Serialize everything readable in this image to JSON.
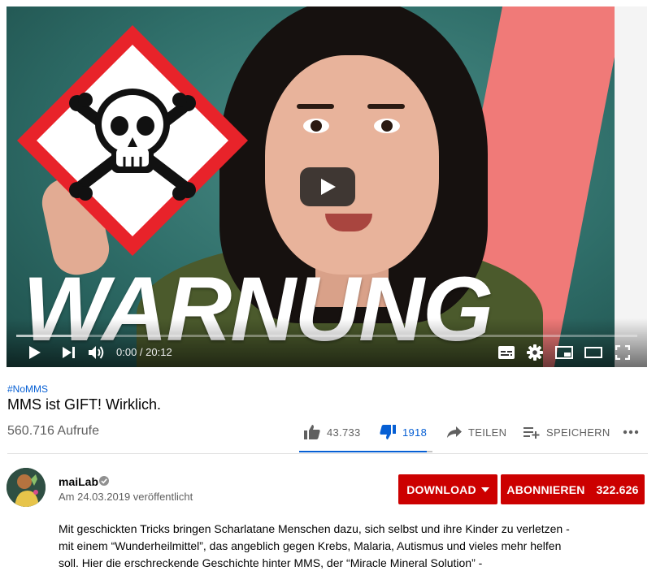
{
  "player": {
    "thumbnail_text": "WARNUNG",
    "time_current": "0:00",
    "time_separator": " / ",
    "time_total": "20:12",
    "progress_loaded_fraction": 0.09,
    "icons": [
      "play-icon",
      "next-icon",
      "volume-icon",
      "subtitles-icon",
      "settings-icon",
      "miniplayer-icon",
      "theater-mode-icon",
      "fullscreen-icon"
    ]
  },
  "video": {
    "hashtag": "#NoMMS",
    "title": "MMS ist GIFT! Wirklich.",
    "views": "560.716 Aufrufe"
  },
  "actions": {
    "like_count": "43.733",
    "dislike_count": "1918",
    "share_label": "TEILEN",
    "save_label": "SPEICHERN",
    "like_ratio": 0.958
  },
  "channel": {
    "name": "maiLab",
    "published": "Am 24.03.2019 veröffentlicht",
    "download_label": "DOWNLOAD",
    "subscribe_label": "ABONNIEREN",
    "subscriber_count": "322.626"
  },
  "description": {
    "text": "Mit geschickten Tricks bringen Scharlatane Menschen dazu, sich selbst und ihre Kinder zu verletzen - mit einem “Wunderheilmittel”, das angeblich gegen Krebs, Malaria, Autismus und vieles mehr helfen soll. Hier die erschreckende Geschichte hinter MMS, der “Miracle Mineral Solution” -"
  },
  "colors": {
    "accent_blue": "#065fd4",
    "button_red": "#cc0000",
    "hazard_red": "#e8232a",
    "secondary_text": "#606060"
  }
}
